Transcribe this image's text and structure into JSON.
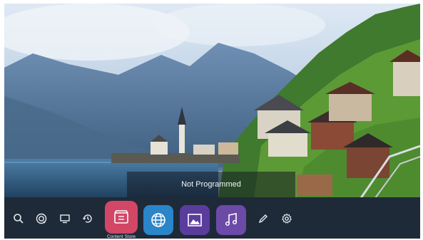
{
  "overlay": {
    "status_text": "Not Programmed"
  },
  "launcher": {
    "icons": {
      "search": "search-icon",
      "settings_source": "live-tv-icon",
      "input": "monitor-icon",
      "recent": "history-icon",
      "edit": "pencil-icon",
      "settings": "gear-icon"
    },
    "apps": [
      {
        "label": "Content Store",
        "icon": "store-icon",
        "color": "#d24666"
      },
      {
        "label": "",
        "icon": "globe-icon",
        "color": "#2b85c9"
      },
      {
        "label": "",
        "icon": "image-icon",
        "color": "#5a3c9d"
      },
      {
        "label": "",
        "icon": "music-note-icon",
        "color": "#6c4aa8"
      }
    ]
  },
  "colors": {
    "bar_background": "#1f2a38",
    "accent": "#d24666"
  }
}
